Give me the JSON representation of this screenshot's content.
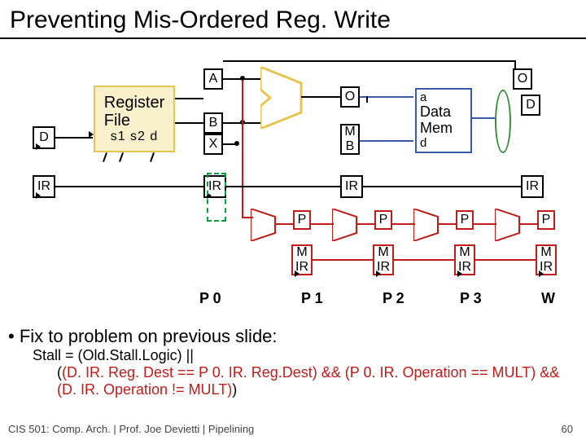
{
  "title": "Preventing Mis-Ordered Reg. Write",
  "regfile": {
    "title": "Register\nFile",
    "ports": "s1 s2  d"
  },
  "latch": {
    "A": "A",
    "B": "B",
    "X": "X",
    "IR": "IR",
    "D": "D",
    "O": "O",
    "MB": "M\nB",
    "P": "P",
    "MIR": "M\nIR"
  },
  "datamem": {
    "a": "a",
    "label": "Data\nMem",
    "d": "d"
  },
  "stages": {
    "P0": "P 0",
    "P1": "P 1",
    "P2": "P 2",
    "P3": "P 3",
    "W": "W"
  },
  "bullet": {
    "main": "Fix to problem on previous slide:",
    "line1": "Stall = (Old.Stall.Logic) ||",
    "line2a": "(",
    "line2b": "(D. IR. Reg. Dest == P 0. IR. Reg.Dest) && (P 0. IR. Operation == MULT) && (D. IR. Operation != MULT)",
    "line2c": ")"
  },
  "footer": "CIS 501: Comp. Arch.   |   Prof. Joe Devietti   |   Pipelining",
  "pagenum": "60"
}
